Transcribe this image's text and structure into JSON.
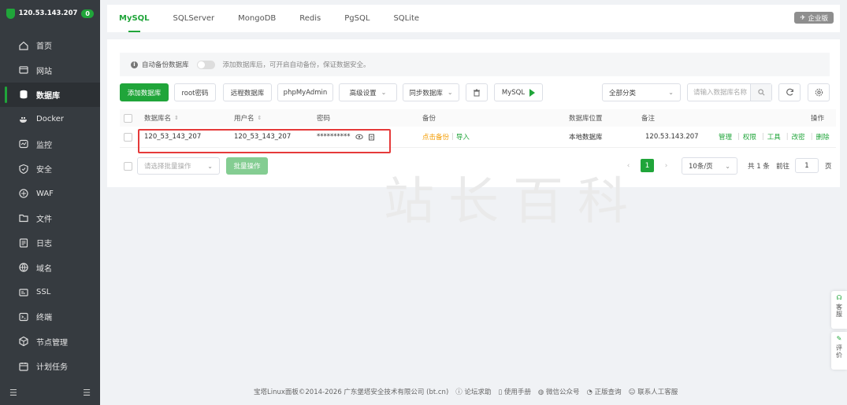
{
  "sidebar": {
    "server_ip": "120.53.143.207",
    "badge_count": "0",
    "items": [
      {
        "label": "首页",
        "icon": "home-icon"
      },
      {
        "label": "网站",
        "icon": "globe-icon"
      },
      {
        "label": "数据库",
        "icon": "database-icon",
        "active": true
      },
      {
        "label": "Docker",
        "icon": "docker-icon"
      },
      {
        "label": "监控",
        "icon": "monitor-icon"
      },
      {
        "label": "安全",
        "icon": "shield-icon"
      },
      {
        "label": "WAF",
        "icon": "waf-icon"
      },
      {
        "label": "文件",
        "icon": "folder-icon"
      },
      {
        "label": "日志",
        "icon": "log-icon"
      },
      {
        "label": "域名",
        "icon": "domain-icon"
      },
      {
        "label": "SSL",
        "icon": "ssl-icon"
      },
      {
        "label": "终端",
        "icon": "terminal-icon"
      },
      {
        "label": "节点管理",
        "icon": "node-icon"
      },
      {
        "label": "计划任务",
        "icon": "calendar-icon"
      }
    ]
  },
  "tabs": [
    "MySQL",
    "SQLServer",
    "MongoDB",
    "Redis",
    "PgSQL",
    "SQLite"
  ],
  "enterprise_label": "企业版",
  "notice": {
    "label": "自动备份数据库",
    "tip": "添加数据库后，可开启自动备份，保证数据安全。"
  },
  "toolbar": {
    "add_db": "添加数据库",
    "root_pwd": "root密码",
    "remote_db": "远程数据库",
    "phpmyadmin": "phpMyAdmin",
    "advanced": "高级设置",
    "sync_db": "同步数据库",
    "mysql_btn": "MySQL",
    "category": "全部分类",
    "search_placeholder": "请输入数据库名称"
  },
  "table": {
    "headers": {
      "db_name": "数据库名",
      "username": "用户名",
      "password": "密码",
      "backup": "备份",
      "location": "数据库位置",
      "remark": "备注",
      "actions": "操作"
    },
    "rows": [
      {
        "db_name": "120_53_143_207",
        "username": "120_53_143_207",
        "password": "**********",
        "backup_action": "点击备份",
        "import_action": "导入",
        "location": "本地数据库",
        "remark": "120.53.143.207",
        "ops": [
          "管理",
          "权限",
          "工具",
          "改密",
          "删除"
        ]
      }
    ]
  },
  "batch": {
    "placeholder": "请选择批量操作",
    "button": "批量操作"
  },
  "pager": {
    "current": "1",
    "per_page": "10条/页",
    "total": "共 1 条",
    "goto_label": "前往",
    "goto_value": "1",
    "page_unit": "页"
  },
  "footer": {
    "copyright": "宝塔Linux面板©2014-2026 广东堡塔安全技术有限公司 (bt.cn)",
    "forum": "论坛求助",
    "manual": "使用手册",
    "wechat": "微信公众号",
    "verify": "正版查询",
    "support": "联系人工客服"
  },
  "float": {
    "service": "客服",
    "review": "评价"
  },
  "watermark": "站长百科",
  "colors": {
    "brand": "#20a53a",
    "sidebar_bg": "#363b40",
    "highlight": "#e53a3a",
    "backup_link": "#f39b00"
  }
}
